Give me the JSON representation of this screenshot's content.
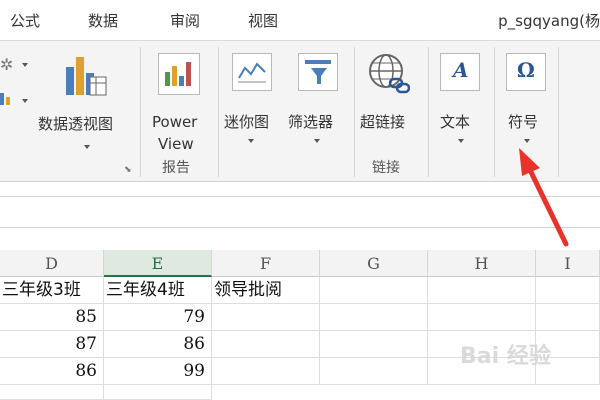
{
  "tabs": {
    "formulas": "公式",
    "data": "数据",
    "review": "审阅",
    "view": "视图"
  },
  "window_title": "p_sgqyang(杨",
  "ribbon": {
    "pivotchart_label": "数据透视图",
    "powerview_line1": "Power",
    "powerview_line2": "View",
    "reports_group": "报告",
    "sparkline_label": "迷你图",
    "filter_label": "筛选器",
    "hyperlink_label": "超链接",
    "links_group": "链接",
    "text_label": "文本",
    "symbol_label": "符号",
    "text_icon_glyph": "A",
    "symbol_icon_glyph": "Ω"
  },
  "columns": [
    "D",
    "E",
    "F",
    "G",
    "H",
    "I"
  ],
  "selected_column": "E",
  "rows": [
    [
      "三年级3班",
      "三年级4班",
      "领导批阅",
      "",
      "",
      ""
    ],
    [
      "85",
      "79",
      "",
      "",
      "",
      ""
    ],
    [
      "87",
      "86",
      "",
      "",
      "",
      ""
    ],
    [
      "86",
      "99",
      "",
      "",
      "",
      ""
    ]
  ],
  "watermark": "Bai 经验",
  "colors": {
    "accent_green": "#217346",
    "arrow_red": "#e8322c",
    "ribbon_bg": "#f4f4f4"
  }
}
